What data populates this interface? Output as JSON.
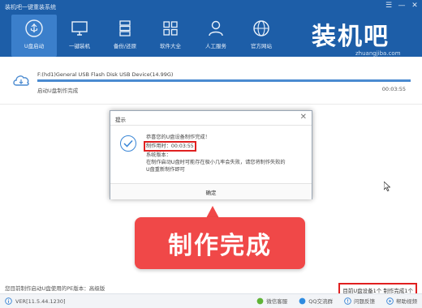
{
  "window": {
    "title": "装机吧一键重装系统",
    "buttons": [
      "☰",
      "—",
      "✕"
    ]
  },
  "nav": [
    {
      "label": "U盘启动",
      "icon": "usb-icon",
      "active": true
    },
    {
      "label": "一键装机",
      "icon": "monitor-icon",
      "active": false
    },
    {
      "label": "备份/还原",
      "icon": "server-icon",
      "active": false
    },
    {
      "label": "软件大全",
      "icon": "apps-icon",
      "active": false
    },
    {
      "label": "人工服务",
      "icon": "user-icon",
      "active": false
    },
    {
      "label": "官方网站",
      "icon": "globe-icon",
      "active": false
    }
  ],
  "logo": {
    "main": "装机吧",
    "sub": "zhuangjiba.com"
  },
  "task": {
    "device": "F:(hd1)General USB Flash Disk USB Device(14.99G)",
    "status": "启动U盘制作完成",
    "time": "00:03:55",
    "progress_percent": 100
  },
  "dialog": {
    "title": "提示",
    "close": "✕",
    "lines": [
      "恭喜您的U盘设备制作完成！",
      "制作用时：00:03:55",
      "系统版本：",
      "在制作启动U盘时可能存在极小几率会失败，请您将制作失败的",
      "U盘重新制作即可"
    ],
    "ok_label": "确定"
  },
  "callout": {
    "text": "制作完成"
  },
  "footer": {
    "hint": "您目前制作启动U盘使用的PE版本：高级版",
    "device_count": "目前U盘设备1个 制作完成1个"
  },
  "statusbar": {
    "version": "VER[11.5.44.1230]",
    "links": [
      {
        "label": "微信客服",
        "icon": "wechat-icon"
      },
      {
        "label": "QQ交流群",
        "icon": "qq-icon"
      },
      {
        "label": "问题反馈",
        "icon": "feedback-icon"
      },
      {
        "label": "帮助视频",
        "icon": "video-icon"
      }
    ]
  },
  "colors": {
    "header": "#1d5ea8",
    "accent": "#3b7fcb",
    "callout": "#f04848",
    "highlight": "#e02020"
  }
}
